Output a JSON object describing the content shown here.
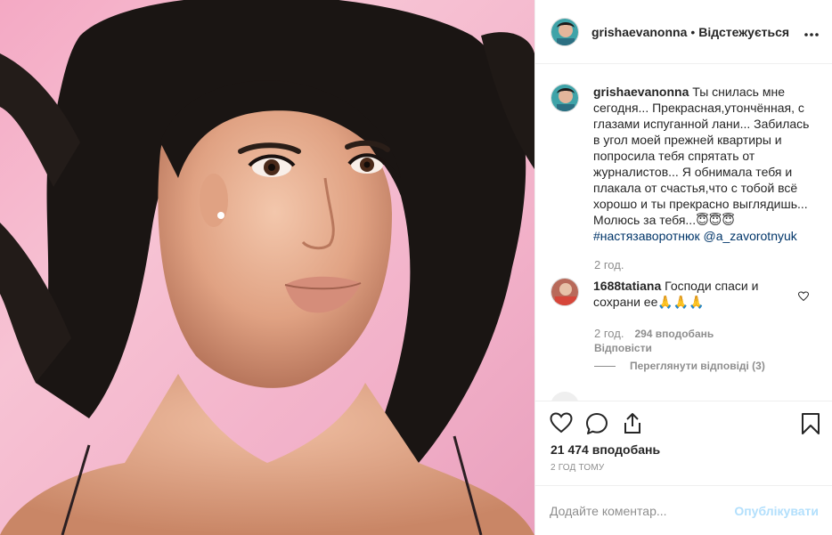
{
  "post": {
    "username": "grishaevanonna",
    "separator": "•",
    "follow_status": "Відстежується",
    "more_icon": "more-horizontal-icon"
  },
  "caption": {
    "username": "grishaevanonna",
    "text": "Ты снилась мне сегодня... Прекрасная,утончённая, с глазами испуганной лани... Забилась в угол моей прежней квартиры и попросила тебя спрятать от журналистов... Я обнимала тебя и плакала от счастья,что с тобой всё хорошо и ты прекрасно выглядишь... Молюсь за тебя...😇😇😇",
    "hashtag": "#настязаворотнюк",
    "mention": "@a_zavorotnyuk",
    "time": "2 год."
  },
  "comments": [
    {
      "username": "1688tatiana",
      "text": "Господи спаси и сохрани ее🙏🙏🙏",
      "time": "2 год.",
      "likes": "294 вподобань",
      "reply_label": "Відповісти",
      "view_replies": "Переглянути відповіді (3)"
    }
  ],
  "footer": {
    "likes": "21 474 вподобань",
    "post_time": "2 ГОД ТОМУ",
    "comment_placeholder": "Додайте коментар...",
    "publish_label": "Опублікувати"
  },
  "colors": {
    "text": "#262626",
    "secondary": "#8e8e8e",
    "link": "#003569",
    "publish_disabled": "#b2dffc",
    "border": "#efefef"
  }
}
